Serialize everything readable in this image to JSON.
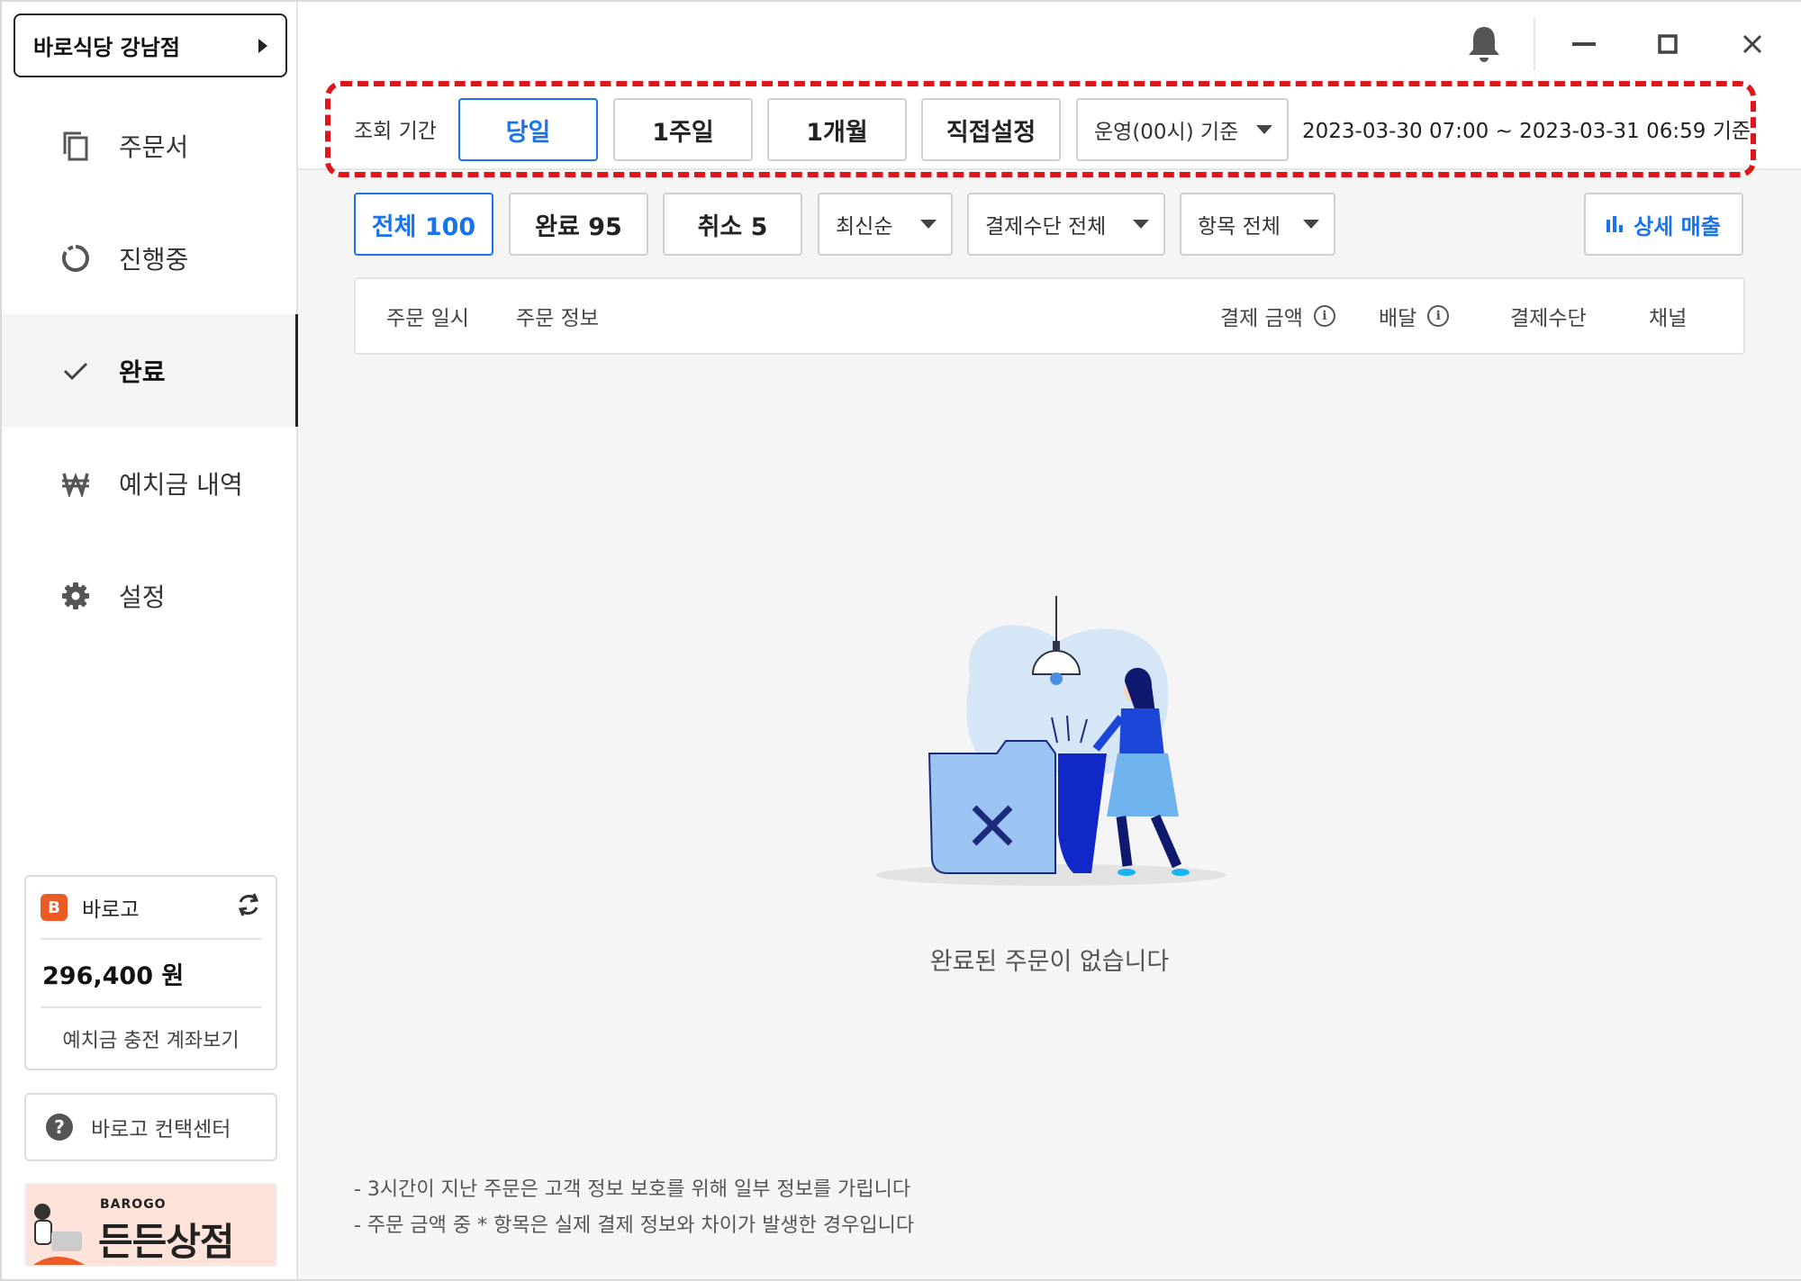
{
  "sidebar": {
    "store_name": "바로식당 강남점",
    "items": [
      {
        "label": "주문서",
        "icon": "copy-icon"
      },
      {
        "label": "진행중",
        "icon": "progress-icon"
      },
      {
        "label": "완료",
        "icon": "check-icon"
      },
      {
        "label": "예치금 내역",
        "icon": "won-icon"
      },
      {
        "label": "설정",
        "icon": "gear-icon"
      }
    ],
    "active_index": 2,
    "wallet": {
      "brand": "바로고",
      "amount": "296,400 원",
      "link": "예치금 충전 계좌보기"
    },
    "contact": "바로고 컨택센터",
    "banner": {
      "brand": "BAROGO",
      "title": "든든상점"
    }
  },
  "titlebar": {
    "icons": [
      "bell-icon",
      "minimize-icon",
      "maximize-icon",
      "close-icon"
    ]
  },
  "period": {
    "label": "조회 기간",
    "buttons": [
      "당일",
      "1주일",
      "1개월",
      "직접설정"
    ],
    "selected": 0,
    "basis": "운영(00시) 기준",
    "range": "2023-03-30 07:00 ~ 2023-03-31  06:59 기준"
  },
  "filters": {
    "tabs": [
      "전체 100",
      "완료 95",
      "취소 5"
    ],
    "selected": 0,
    "sort": "최신순",
    "payment": "결제수단 전체",
    "items": "항목 전체",
    "detail": "상세 매출"
  },
  "table": {
    "columns": [
      "주문 일시",
      "주문 정보",
      "결제 금액",
      "배달",
      "결제수단",
      "채널"
    ]
  },
  "empty": {
    "message": "완료된 주문이 없습니다"
  },
  "notes": [
    "- 3시간이 지난 주문은 고객 정보 보호를 위해 일부 정보를 가립니다",
    "- 주문 금액 중 * 항목은 실제 결제 정보와 차이가 발생한 경우입니다"
  ],
  "colors": {
    "accent": "#1a73e8",
    "highlight_border": "#e1141a",
    "brand_orange": "#ec5a26"
  }
}
